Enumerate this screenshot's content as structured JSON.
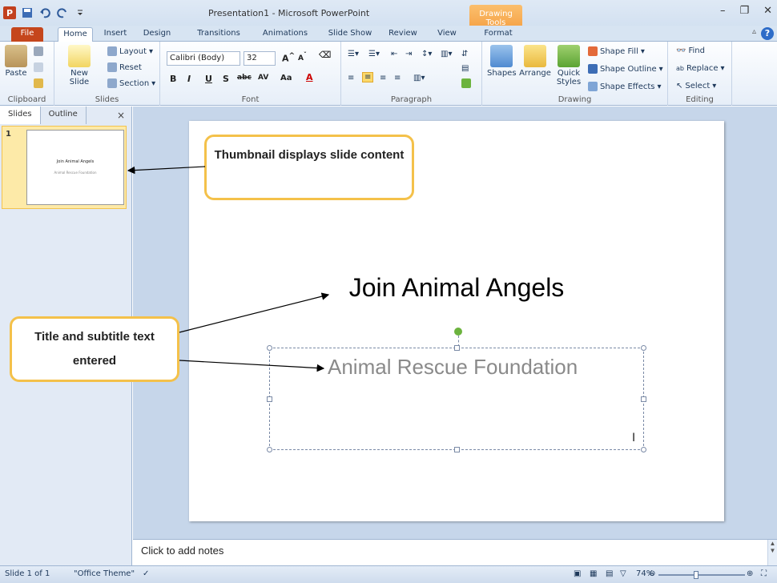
{
  "window": {
    "title": "Presentation1 - Microsoft PowerPoint",
    "contextual_tab": "Drawing Tools",
    "app_icon": "P"
  },
  "tabs": [
    {
      "label": "File"
    },
    {
      "label": "Home"
    },
    {
      "label": "Insert"
    },
    {
      "label": "Design"
    },
    {
      "label": "Transitions"
    },
    {
      "label": "Animations"
    },
    {
      "label": "Slide Show"
    },
    {
      "label": "Review"
    },
    {
      "label": "View"
    },
    {
      "label": "Format"
    }
  ],
  "ribbon": {
    "clipboard": {
      "label": "Clipboard",
      "paste": "Paste"
    },
    "slides": {
      "label": "Slides",
      "new_slide": "New Slide",
      "layout": "Layout",
      "reset": "Reset",
      "section": "Section"
    },
    "font": {
      "label": "Font",
      "font_name": "Calibri (Body)",
      "font_size": "32"
    },
    "paragraph": {
      "label": "Paragraph"
    },
    "drawing": {
      "label": "Drawing",
      "shapes": "Shapes",
      "arrange": "Arrange",
      "quick_styles": "Quick Styles",
      "shape_fill": "Shape Fill",
      "shape_outline": "Shape Outline",
      "shape_effects": "Shape Effects"
    },
    "editing": {
      "label": "Editing",
      "find": "Find",
      "replace": "Replace",
      "select": "Select"
    }
  },
  "pane": {
    "tab_slides": "Slides",
    "tab_outline": "Outline",
    "close": "×",
    "thumb_number": "1",
    "thumb_title": "Join Animal Angels",
    "thumb_subtitle": "Animal Rescue Foundation"
  },
  "slide": {
    "title": "Join Animal Angels",
    "subtitle": "Animal Rescue Foundation"
  },
  "notes": {
    "placeholder": "Click to add notes"
  },
  "status": {
    "slide_of": "Slide 1 of 1",
    "theme": "\"Office Theme\"",
    "zoom": "74%",
    "zoom_fraction": 0.74
  },
  "callouts": {
    "thumbnail": "Thumbnail displays slide content",
    "title_text": "Title and subtitle text entered"
  },
  "colors": {
    "file_tab": "#c5461c",
    "contextual_tab": "#f6a64b",
    "callout_border": "#f4c14a",
    "handle_rotate": "#6cb33e"
  }
}
